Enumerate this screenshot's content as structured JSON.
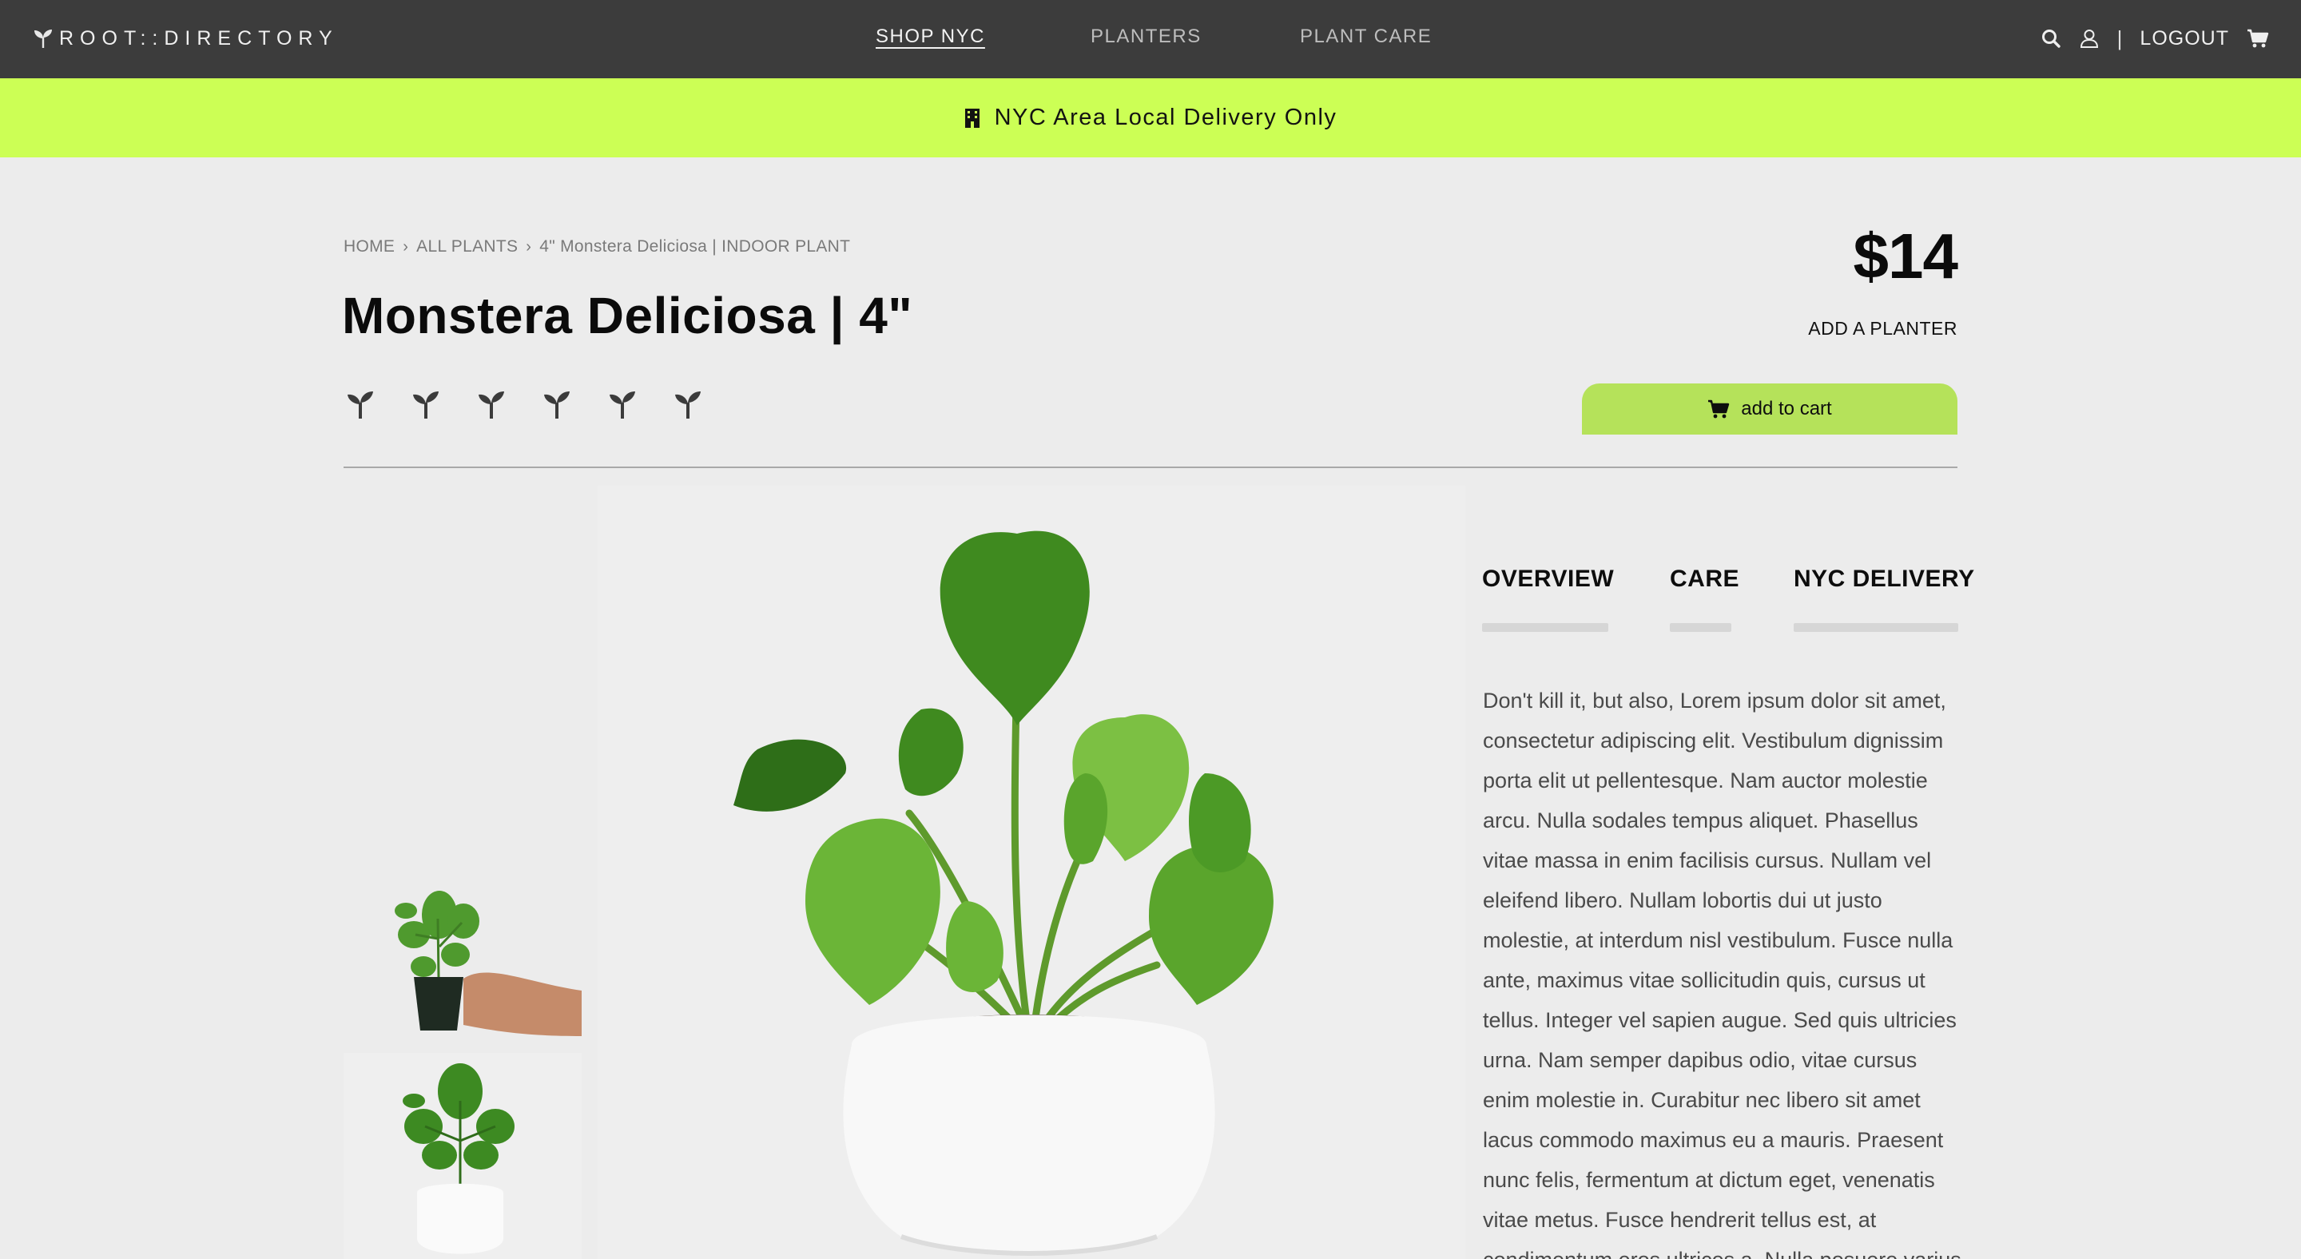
{
  "brand": {
    "name": "ROOT::DIRECTORY",
    "icon": "sprout-icon"
  },
  "nav": {
    "links": [
      {
        "label": "SHOP NYC",
        "active": true
      },
      {
        "label": "PLANTERS",
        "active": false
      },
      {
        "label": "PLANT CARE",
        "active": false
      }
    ],
    "search_icon": "search-icon",
    "user_icon": "user-icon",
    "separator": "|",
    "logout_label": "LOGOUT",
    "cart_icon": "cart-icon"
  },
  "banner": {
    "icon": "building-icon",
    "text": "NYC Area Local Delivery Only",
    "color": "#ccff55"
  },
  "breadcrumb": {
    "items": [
      "HOME",
      "ALL PLANTS",
      "4\" Monstera Deliciosa | INDOOR PLANT"
    ]
  },
  "product": {
    "title": "Monstera Deliciosa | 4\"",
    "rating_icons": 6,
    "price": "$14",
    "add_planter_label": "ADD A PLANTER",
    "add_to_cart_label": "add to cart"
  },
  "tabs": [
    {
      "label": "OVERVIEW"
    },
    {
      "label": "CARE"
    },
    {
      "label": "NYC DELIVERY"
    }
  ],
  "description": "Don't kill it, but also, Lorem ipsum dolor sit amet, consectetur adipiscing elit. Vestibulum dignissim porta elit ut pellentesque. Nam auctor molestie arcu. Nulla sodales tempus aliquet. Phasellus vitae massa in enim facilisis cursus. Nullam vel eleifend libero. Nullam lobortis dui ut justo molestie, at interdum nisl vestibulum. Fusce nulla ante, maximus vitae sollicitudin quis, cursus ut tellus. Integer vel sapien augue. Sed quis ultricies urna. Nam semper dapibus odio, vitae cursus enim molestie in. Curabitur nec libero sit amet lacus commodo maximus eu a mauris. Praesent nunc felis, fermentum at dictum eget, venenatis vitae metus. Fusce hendrerit tellus est, at condimentum eros ultrices a. Nulla posuere varius odio, non convallis tellus elementum non.",
  "colors": {
    "nav_bg": "#3c3c3c",
    "accent": "#ccff55",
    "button": "#b5e25a",
    "page_bg": "#ececec"
  }
}
